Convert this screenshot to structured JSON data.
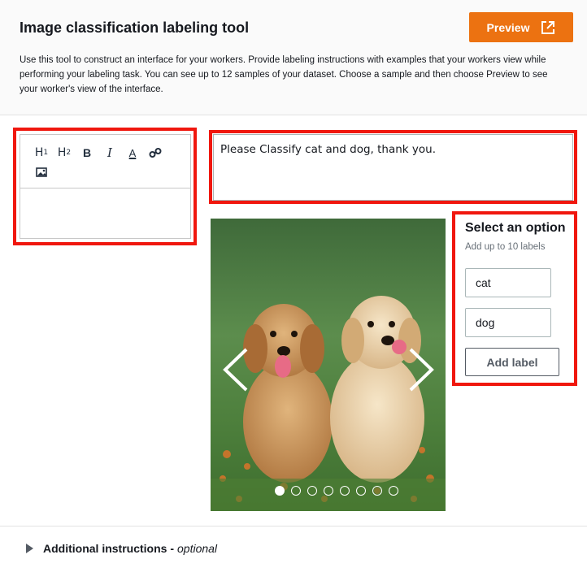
{
  "header": {
    "title": "Image classification labeling tool",
    "preview_label": "Preview",
    "description": "Use this tool to construct an interface for your workers. Provide labeling instructions with examples that your workers view while performing your labeling task. You can see up to 12 samples of your dataset. Choose a sample and then choose Preview to see your worker's view of the interface."
  },
  "editor": {
    "toolbar": [
      {
        "name": "heading1-icon",
        "glyph": "H",
        "sub": "1"
      },
      {
        "name": "heading2-icon",
        "glyph": "H",
        "sub": "2"
      },
      {
        "name": "bold-icon",
        "glyph": "B"
      },
      {
        "name": "italic-icon",
        "glyph": "I"
      },
      {
        "name": "text-color-icon",
        "glyph": "A"
      },
      {
        "name": "link-icon"
      },
      {
        "name": "image-icon"
      }
    ]
  },
  "instructions": {
    "text": "Please Classify cat and dog, thank you."
  },
  "carousel": {
    "image_subject": "two golden retriever puppies on grass",
    "total_samples": 8,
    "active_index": 0
  },
  "options": {
    "title": "Select an option",
    "subtitle": "Add up to 10 labels",
    "labels": [
      "cat",
      "dog"
    ],
    "add_label": "Add label"
  },
  "footer": {
    "additional": "Additional instructions -",
    "optional": "optional"
  },
  "colors": {
    "accent": "#ec7211",
    "highlight": "#f0170e"
  }
}
